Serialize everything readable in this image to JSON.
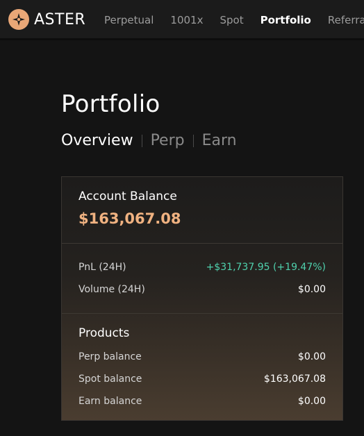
{
  "brand": {
    "name": "ASTER",
    "logo_icon": "aster-star-icon",
    "accent": "#e9a777"
  },
  "nav": {
    "items": [
      {
        "label": "Perpetual",
        "active": false
      },
      {
        "label": "1001x",
        "active": false
      },
      {
        "label": "Spot",
        "active": false
      },
      {
        "label": "Portfolio",
        "active": true
      },
      {
        "label": "Referral",
        "active": false
      }
    ]
  },
  "page": {
    "title": "Portfolio",
    "tabs": [
      {
        "label": "Overview",
        "active": true
      },
      {
        "label": "Perp",
        "active": false
      },
      {
        "label": "Earn",
        "active": false
      }
    ]
  },
  "account": {
    "label": "Account Balance",
    "value": "$163,067.08",
    "value_color": "#f0b281"
  },
  "stats": {
    "pnl_label": "PnL (24H)",
    "pnl_value": "+$31,737.95 (+19.47%)",
    "pnl_color": "#4fd1ad",
    "volume_label": "Volume (24H)",
    "volume_value": "$0.00"
  },
  "products": {
    "title": "Products",
    "items": [
      {
        "label": "Perp balance",
        "value": "$0.00"
      },
      {
        "label": "Spot balance",
        "value": "$163,067.08"
      },
      {
        "label": "Earn balance",
        "value": "$0.00"
      }
    ]
  }
}
